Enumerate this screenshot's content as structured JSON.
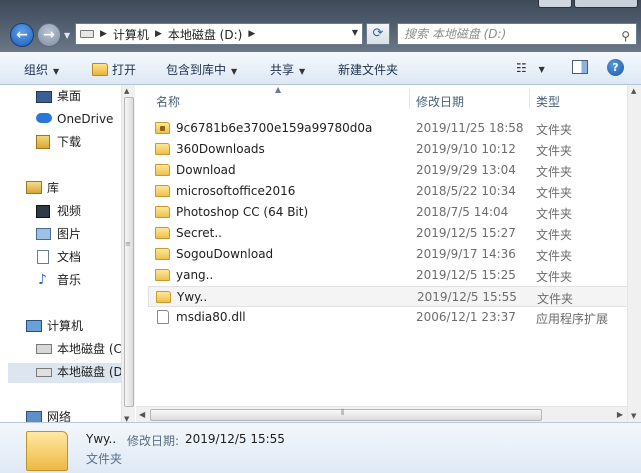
{
  "address": {
    "segments": [
      "计算机",
      "本地磁盘 (D:)"
    ]
  },
  "search": {
    "placeholder": "搜索 本地磁盘 (D:)"
  },
  "toolbar": {
    "organize": "组织",
    "open": "打开",
    "include_in_library": "包含到库中",
    "share": "共享",
    "new_folder": "新建文件夹"
  },
  "nav": {
    "desktop": "桌面",
    "onedrive": "OneDrive",
    "downloads": "下载",
    "library": "库",
    "videos": "视频",
    "pictures": "图片",
    "documents": "文档",
    "music": "音乐",
    "computer": "计算机",
    "drive_c": "本地磁盘 (C",
    "drive_d": "本地磁盘 (D",
    "network": "网络"
  },
  "columns": {
    "name": "名称",
    "modified": "修改日期",
    "type": "类型"
  },
  "files": [
    {
      "name": "9c6781b6e3700e159a99780d0a",
      "date": "2019/11/25 18:58",
      "type": "文件夹",
      "icon": "locked-folder-icon"
    },
    {
      "name": "360Downloads",
      "date": "2019/9/10 10:12",
      "type": "文件夹",
      "icon": "folder-icon"
    },
    {
      "name": "Download",
      "date": "2019/9/29 13:04",
      "type": "文件夹",
      "icon": "folder-icon"
    },
    {
      "name": "microsoftoffice2016",
      "date": "2018/5/22 10:34",
      "type": "文件夹",
      "icon": "folder-icon"
    },
    {
      "name": "Photoshop CC (64 Bit)",
      "date": "2018/7/5 14:04",
      "type": "文件夹",
      "icon": "folder-icon"
    },
    {
      "name": "Secret..",
      "date": "2019/12/5 15:27",
      "type": "文件夹",
      "icon": "folder-icon"
    },
    {
      "name": "SogouDownload",
      "date": "2019/9/17 14:36",
      "type": "文件夹",
      "icon": "folder-icon"
    },
    {
      "name": "yang..",
      "date": "2019/12/5 15:25",
      "type": "文件夹",
      "icon": "folder-icon"
    },
    {
      "name": "Ywy..",
      "date": "2019/12/5 15:55",
      "type": "文件夹",
      "icon": "folder-icon"
    },
    {
      "name": "msdia80.dll",
      "date": "2006/12/1 23:37",
      "type": "应用程序扩展",
      "icon": "dll-file-icon"
    }
  ],
  "details": {
    "name": "Ywy..",
    "modified_label": "修改日期:",
    "modified_value": "2019/12/5 15:55",
    "type": "文件夹"
  }
}
